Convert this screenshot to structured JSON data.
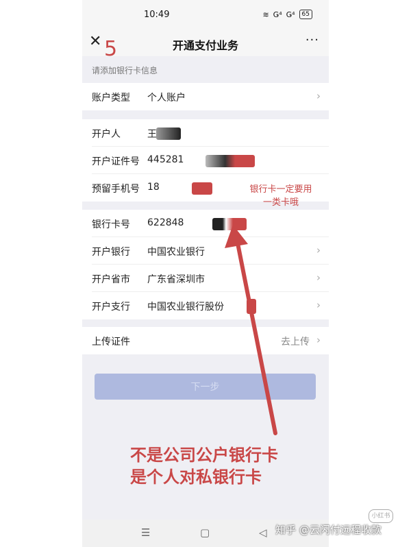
{
  "status": {
    "time": "10:49",
    "signal1": "Ǥ⁴",
    "signal2": "Ǥ⁴",
    "battery": "65"
  },
  "header": {
    "close": "✕",
    "step": "5",
    "title": "开通支付业务",
    "more": "···"
  },
  "hint": "请添加银行卡信息",
  "account": {
    "label": "账户类型",
    "value": "个人账户"
  },
  "personal": {
    "holder": {
      "label": "开户人",
      "value": "王"
    },
    "id": {
      "label": "开户证件号",
      "value": "445281"
    },
    "phone": {
      "label": "预留手机号",
      "value": "18"
    }
  },
  "bank": {
    "card": {
      "label": "银行卡号",
      "value": "622848"
    },
    "bank_name": {
      "label": "开户银行",
      "value": "中国农业银行"
    },
    "province": {
      "label": "开户省市",
      "value": "广东省深圳市"
    },
    "branch": {
      "label": "开户支行",
      "value": "中国农业银行股份"
    }
  },
  "upload": {
    "label": "上传证件",
    "action": "去上传"
  },
  "next_button": "下一步",
  "annotations": {
    "note_small_1": "银行卡一定要用",
    "note_small_2": "一类卡哦",
    "note_big_1": "不是公司公户银行卡",
    "note_big_2": "是个人对私银行卡"
  },
  "watermark": "知乎 @云闪付远程收款",
  "stamp": "小红书",
  "colors": {
    "accent": "#c94747",
    "button": "#aeb9df"
  }
}
